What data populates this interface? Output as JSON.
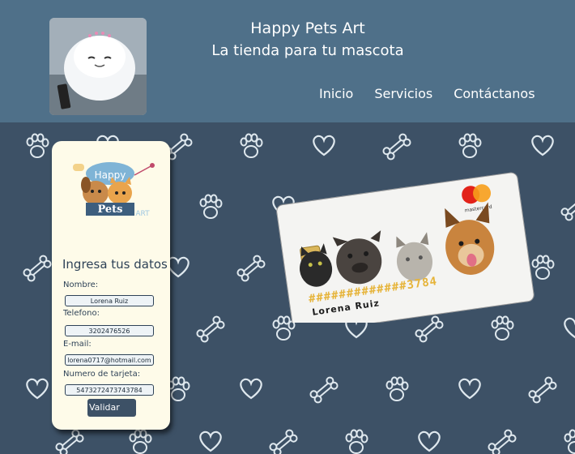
{
  "brand": {
    "title": "Happy Pets Art",
    "subtitle": "La tienda para tu mascota"
  },
  "nav": [
    {
      "label": "Inicio"
    },
    {
      "label": "Servicios"
    },
    {
      "label": "Contáctanos"
    }
  ],
  "logo": {
    "line1": "Happy",
    "line2": "Pets",
    "line3": "ART"
  },
  "form": {
    "title": "Ingresa tus datos",
    "fields": [
      {
        "label": "Nombre:",
        "value": "Lorena Ruiz"
      },
      {
        "label": "Telefono:",
        "value": "3202476526"
      },
      {
        "label": "E-mail:",
        "value": "lorena0717@hotmail.com"
      },
      {
        "label": "Numero de tarjeta:",
        "value": "5473272473743784"
      }
    ],
    "submit_label": "Validar"
  },
  "card": {
    "number": "#############3784",
    "holder": "Lorena Ruiz",
    "network": "mastercard"
  },
  "colors": {
    "header": "#4f7089",
    "background": "#3d5166",
    "panel": "#fefbe9",
    "pattern": "#dfe8ee"
  }
}
